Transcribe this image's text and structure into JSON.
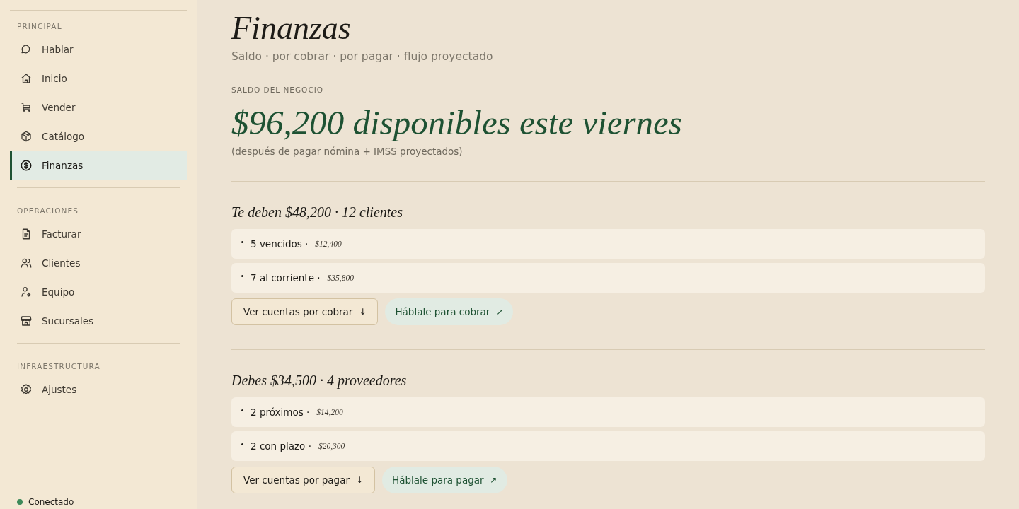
{
  "sidebar": {
    "sections": [
      {
        "title": "PRINCIPAL",
        "items": [
          {
            "label": "Hablar",
            "kind": "chat",
            "selected": false
          },
          {
            "label": "Inicio",
            "kind": "home",
            "selected": false
          },
          {
            "label": "Vender",
            "kind": "cart",
            "selected": false
          },
          {
            "label": "Catálogo",
            "kind": "box",
            "selected": false
          },
          {
            "label": "Finanzas",
            "kind": "dollar",
            "selected": true
          }
        ]
      },
      {
        "title": "OPERACIONES",
        "items": [
          {
            "label": "Facturar",
            "kind": "doc",
            "selected": false
          },
          {
            "label": "Clientes",
            "kind": "users",
            "selected": false
          },
          {
            "label": "Equipo",
            "kind": "usergear",
            "selected": false
          },
          {
            "label": "Sucursales",
            "kind": "store",
            "selected": false
          }
        ]
      },
      {
        "title": "INFRAESTRUCTURA",
        "items": [
          {
            "label": "Ajustes",
            "kind": "gear",
            "selected": false
          }
        ]
      }
    ],
    "status": {
      "label": "Conectado",
      "color": "#3d8a5a"
    }
  },
  "page": {
    "title": "Finanzas",
    "subtitle": "Saldo · por cobrar · por pagar · flujo proyectado",
    "balance": {
      "label": "SALDO DEL NEGOCIO",
      "amount": "$96,200 disponibles este viernes",
      "note": "(después de pagar nómina + IMSS proyectados)"
    },
    "sections": [
      {
        "heading": "Te deben $48,200 · 12 clientes",
        "rows": [
          {
            "label": "5 vencidos ·",
            "amount": "$12,400"
          },
          {
            "label": "7 al corriente ·",
            "amount": "$35,800"
          }
        ],
        "actions": [
          {
            "kind": "outline",
            "label": "Ver cuentas por cobrar",
            "icon": "↓"
          },
          {
            "kind": "pill",
            "label": "Háblale para cobrar",
            "icon": "↗"
          }
        ]
      },
      {
        "heading": "Debes $34,500 · 4 proveedores",
        "rows": [
          {
            "label": "2 próximos ·",
            "amount": "$14,200"
          },
          {
            "label": "2 con plazo ·",
            "amount": "$20,300"
          }
        ],
        "actions": [
          {
            "kind": "outline",
            "label": "Ver cuentas por pagar",
            "icon": "↓"
          },
          {
            "kind": "pill",
            "label": "Háblale para pagar",
            "icon": "↗"
          }
        ]
      }
    ]
  }
}
